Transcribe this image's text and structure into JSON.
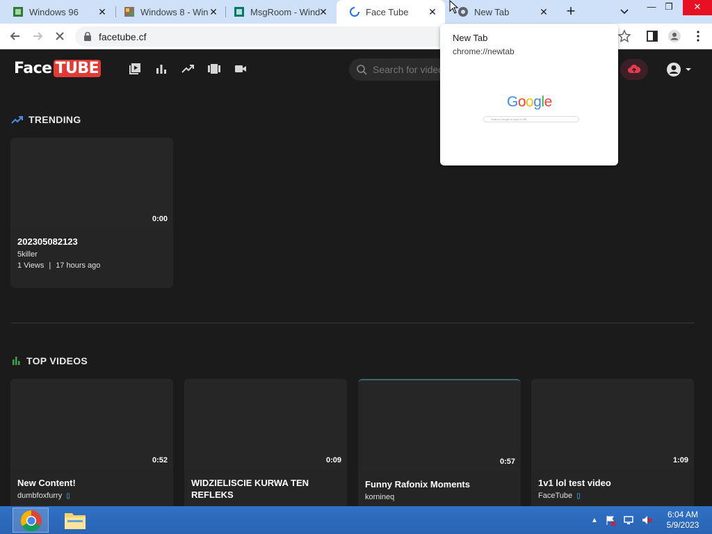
{
  "browser": {
    "tabs": [
      {
        "title": "Windows 96",
        "favicon": "windows96-favicon",
        "active": false
      },
      {
        "title": "Windows 8 - Win",
        "favicon": "windows8-favicon",
        "active": false
      },
      {
        "title": "MsgRoom - Wind",
        "favicon": "msgroom-favicon",
        "active": false
      },
      {
        "title": "Face Tube",
        "favicon": "loading-spinner",
        "active": true
      },
      {
        "title": "New Tab",
        "favicon": "chrome-favicon",
        "active": false
      }
    ],
    "address": "facetube.cf",
    "hover_card": {
      "title": "New Tab",
      "url": "chrome://newtab",
      "preview_logo": "Google",
      "preview_search_placeholder": "Search Google or type a URL"
    }
  },
  "site": {
    "logo_face": "Face",
    "logo_tube": "TUBE",
    "search_placeholder": "Search for videos",
    "trending": {
      "heading": "TRENDING",
      "videos": [
        {
          "title": "202305082123",
          "author": "5killer",
          "views": "1 Views",
          "age": "17 hours ago",
          "duration": "0:00"
        }
      ]
    },
    "top": {
      "heading": "TOP VIDEOS",
      "videos": [
        {
          "title": "New Content!",
          "author": "dumbfoxfurry",
          "verified": true,
          "duration": "0:52"
        },
        {
          "title": "WIDZIELISCIE KURWA TEN REFLEKS",
          "author": "",
          "verified": false,
          "duration": "0:09"
        },
        {
          "title": "Funny Rafonix Moments",
          "author": "kornineq",
          "verified": false,
          "duration": "0:57"
        },
        {
          "title": "1v1 lol test video",
          "author": "FaceTube",
          "verified": true,
          "duration": "1:09"
        }
      ]
    }
  },
  "taskbar": {
    "time": "6:04 AM",
    "date": "5/9/2023"
  },
  "colors": {
    "accent_trending": "#4a90e2",
    "accent_top": "#43a047",
    "logo_red": "#e53935",
    "verified": "#4fc3f7"
  }
}
